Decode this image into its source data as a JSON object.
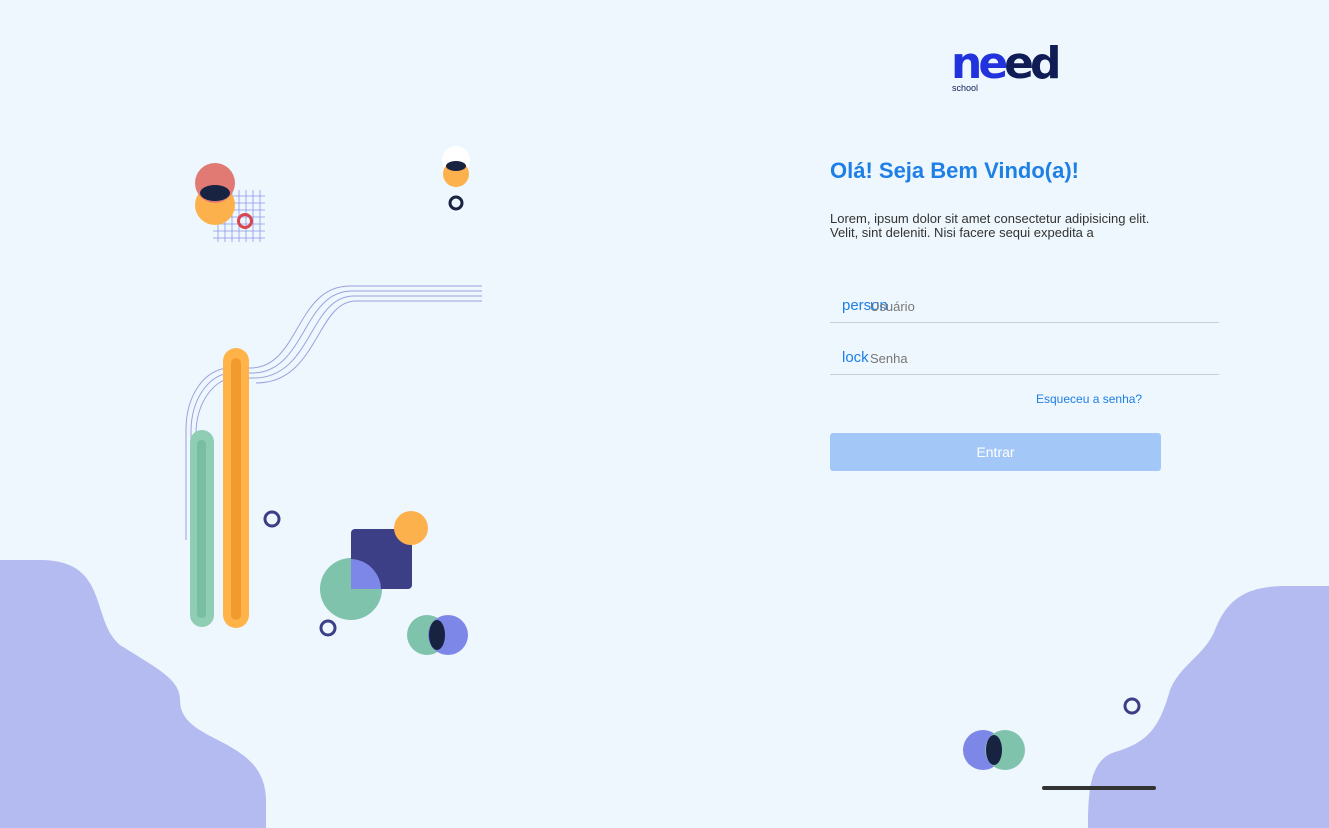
{
  "logo": {
    "word_part1": "ne",
    "word_part2": "ed",
    "subtitle": "school"
  },
  "heading": "Olá! Seja Bem Vindo(a)!",
  "description": "Lorem, ipsum dolor sit amet consectetur adipisicing elit. Velit, sint deleniti. Nisi facere sequi expedita a",
  "username": {
    "icon": "person",
    "placeholder": "Usuário",
    "value": ""
  },
  "password": {
    "icon": "lock",
    "placeholder": "Senha",
    "value": ""
  },
  "forgot_link": "Esqueceu a senha?",
  "submit_label": "Entrar",
  "colors": {
    "background": "#eef7fd",
    "accent": "#1e7fe6",
    "button": "#a3c8f7",
    "blob": "#b4bbf0",
    "orange": "#fdb14d",
    "green": "#7fc3ad",
    "navy": "#3c3f86"
  }
}
